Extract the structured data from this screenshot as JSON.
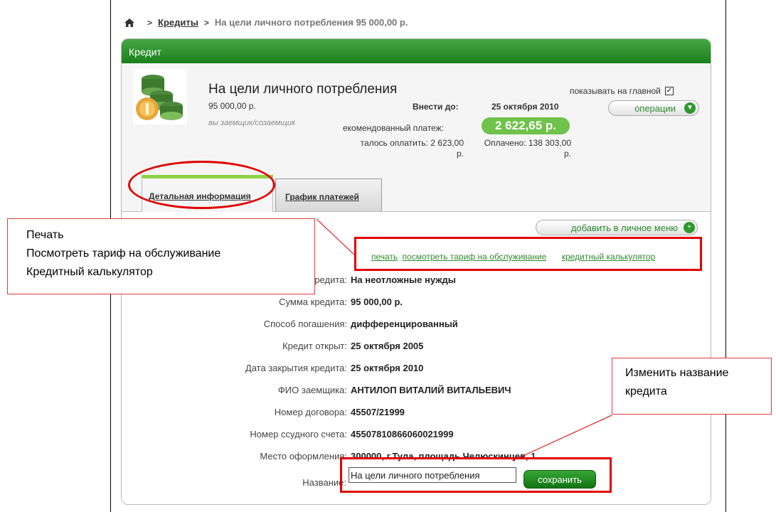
{
  "breadcrumb": {
    "home_icon": "home-icon",
    "link": "Кредиты",
    "current": "На цели личного потребления 95 000,00 р.",
    "separator": ">"
  },
  "panel": {
    "header": "Кредит",
    "loan_title": "На цели личного потребления",
    "loan_amount": "95 000,00 р.",
    "loan_role": "вы заемщик/созаемщик",
    "due_label": "Внести до:",
    "due_date": "25 октября 2010",
    "recommended_label": "екомендованный платеж:",
    "recommended_amount": "2 622,65 р.",
    "remaining_line1": "талось оплатить: 2 623,00",
    "remaining_line2": "р.",
    "paid_line1": "Оплачено: 138 303,00",
    "paid_line2": "р.",
    "show_on_main": "показывать на главной",
    "show_on_main_checked": true,
    "operations_button": "операции",
    "accent_color": "#2e9a2e"
  },
  "tabs": [
    {
      "label": "Детальная информация",
      "active": true
    },
    {
      "label": "График платежей",
      "active": false
    }
  ],
  "content": {
    "add_menu_button": "добавить в личное меню",
    "links": {
      "print": "печать",
      "tariff": "посмотреть тариф на обслуживание",
      "calculator": "кредитный калькулятор"
    },
    "fields": [
      {
        "label": "Цель кредита:",
        "value": "На неотложные нужды"
      },
      {
        "label": "Сумма кредита:",
        "value": "95 000,00 р."
      },
      {
        "label": "Способ погашения:",
        "value": "дифференцированный"
      },
      {
        "label": "Кредит открыт:",
        "value": "25 октября 2005"
      },
      {
        "label": "Дата закрытия кредита:",
        "value": "25 октября 2010"
      },
      {
        "label": "ФИО заемщика:",
        "value": "АНТИЛОП ВИТАЛИЙ ВИТАЛЬЕВИЧ"
      },
      {
        "label": "Номер договора:",
        "value": "45507/21999"
      },
      {
        "label": "Номер ссудного счета:",
        "value": "45507810866060021999"
      },
      {
        "label": "Место оформления:",
        "value": "300000, г.Тула, площадь Челюскинцев, 1"
      }
    ],
    "name_label": "Название:",
    "name_value": "На цели личного потребления",
    "save_button": "сохранить"
  },
  "annotations": {
    "callout_left": [
      "Печать",
      "Посмотреть тариф на обслуживание",
      "Кредитный калькулятор"
    ],
    "callout_right": [
      "Изменить  название",
      "кредита"
    ],
    "highlight_color": "#e10000"
  }
}
